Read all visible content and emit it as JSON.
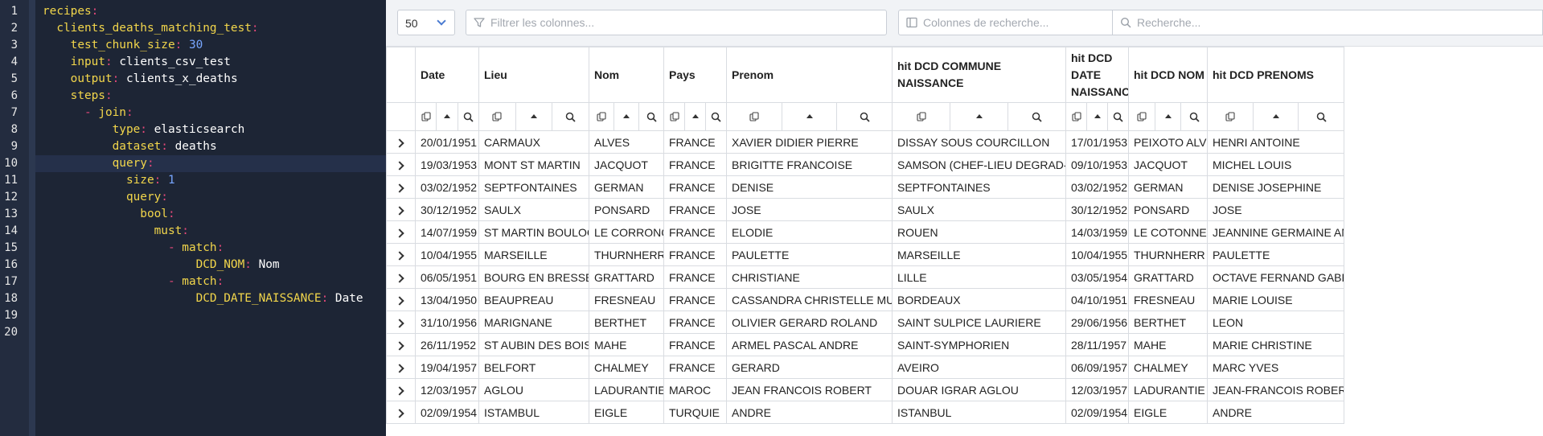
{
  "editor": {
    "line_numbers": [
      "1",
      "2",
      "3",
      "4",
      "5",
      "6",
      "7",
      "8",
      "9",
      "10",
      "11",
      "12",
      "13",
      "14",
      "15",
      "16",
      "17",
      "18",
      "19",
      "20"
    ],
    "lines": [
      {
        "indent": 0,
        "dash": false,
        "key": "recipes",
        "value": "",
        "vtype": ""
      },
      {
        "indent": 2,
        "dash": false,
        "key": "clients_deaths_matching_test",
        "value": "",
        "vtype": ""
      },
      {
        "indent": 4,
        "dash": false,
        "key": "test_chunk_size",
        "value": "30",
        "vtype": "num"
      },
      {
        "indent": 4,
        "dash": false,
        "key": "input",
        "value": "clients_csv_test",
        "vtype": "str"
      },
      {
        "indent": 4,
        "dash": false,
        "key": "output",
        "value": "clients_x_deaths",
        "vtype": "str"
      },
      {
        "indent": 4,
        "dash": false,
        "key": "steps",
        "value": "",
        "vtype": ""
      },
      {
        "indent": 6,
        "dash": true,
        "key": "join",
        "value": "",
        "vtype": ""
      },
      {
        "indent": 10,
        "dash": false,
        "key": "type",
        "value": "elasticsearch",
        "vtype": "str"
      },
      {
        "indent": 10,
        "dash": false,
        "key": "dataset",
        "value": "deaths",
        "vtype": "str"
      },
      {
        "indent": 10,
        "dash": false,
        "key": "query",
        "value": "",
        "vtype": ""
      },
      {
        "indent": 12,
        "dash": false,
        "key": "size",
        "value": "1",
        "vtype": "num"
      },
      {
        "indent": 12,
        "dash": false,
        "key": "query",
        "value": "",
        "vtype": ""
      },
      {
        "indent": 14,
        "dash": false,
        "key": "bool",
        "value": "",
        "vtype": ""
      },
      {
        "indent": 16,
        "dash": false,
        "key": "must",
        "value": "",
        "vtype": ""
      },
      {
        "indent": 18,
        "dash": true,
        "key": "match",
        "value": "",
        "vtype": ""
      },
      {
        "indent": 22,
        "dash": false,
        "key": "DCD_NOM",
        "value": "Nom",
        "vtype": "str"
      },
      {
        "indent": 18,
        "dash": true,
        "key": "match",
        "value": "",
        "vtype": ""
      },
      {
        "indent": 22,
        "dash": false,
        "key": "DCD_DATE_NAISSANCE",
        "value": "Date",
        "vtype": "str"
      },
      {
        "indent": 0,
        "dash": false,
        "key": "",
        "value": "",
        "vtype": ""
      },
      {
        "indent": 0,
        "dash": false,
        "key": "",
        "value": "",
        "vtype": ""
      }
    ],
    "active_line": 10
  },
  "toolbar": {
    "page_size": "50",
    "filter_placeholder": "Filtrer les colonnes...",
    "columns_placeholder": "Colonnes de recherche...",
    "search_placeholder": "Recherche..."
  },
  "table": {
    "columns": [
      "Date",
      "Lieu",
      "Nom",
      "Pays",
      "Prenom",
      "hit DCD COMMUNE NAISSANCE",
      "hit DCD DATE NAISSANCE",
      "hit DCD NOM",
      "hit DCD PRENOMS"
    ],
    "rows": [
      [
        "20/01/1951",
        "CARMAUX",
        "ALVES",
        "FRANCE",
        "XAVIER DIDIER PIERRE",
        "DISSAY SOUS COURCILLON",
        "17/01/1953",
        "PEIXOTO ALVES",
        "HENRI ANTOINE"
      ],
      [
        "19/03/1953",
        "MONT ST MARTIN",
        "JACQUOT",
        "FRANCE",
        "BRIGITTE FRANCOISE",
        "SAMSON (CHEF-LIEU DEGRAD-SAMSO",
        "09/10/1953",
        "JACQUOT",
        "MICHEL LOUIS"
      ],
      [
        "03/02/1952",
        "SEPTFONTAINES",
        "GERMAN",
        "FRANCE",
        "DENISE",
        "SEPTFONTAINES",
        "03/02/1952",
        "GERMAN",
        "DENISE JOSEPHINE"
      ],
      [
        "30/12/1952",
        "SAULX",
        "PONSARD",
        "FRANCE",
        "JOSE",
        "SAULX",
        "30/12/1952",
        "PONSARD",
        "JOSE"
      ],
      [
        "14/07/1959",
        "ST MARTIN BOULOGNE",
        "LE CORRONCQ",
        "FRANCE",
        "ELODIE",
        "ROUEN",
        "14/03/1959",
        "LE COTONNEC",
        "JEANNINE GERMAINE ANTOI"
      ],
      [
        "10/04/1955",
        "MARSEILLE",
        "THURNHERR",
        "FRANCE",
        "PAULETTE",
        "MARSEILLE",
        "10/04/1955",
        "THURNHERR",
        "PAULETTE"
      ],
      [
        "06/05/1951",
        "BOURG EN BRESSE",
        "GRATTARD",
        "FRANCE",
        "CHRISTIANE",
        "LILLE",
        "03/05/1954",
        "GRATTARD",
        "OCTAVE FERNAND GABRIEL"
      ],
      [
        "13/04/1950",
        "BEAUPREAU",
        "FRESNEAU",
        "FRANCE",
        "CASSANDRA CHRISTELLE MURIELLE",
        "BORDEAUX",
        "04/10/1951",
        "FRESNEAU",
        "MARIE LOUISE"
      ],
      [
        "31/10/1956",
        "MARIGNANE",
        "BERTHET",
        "FRANCE",
        "OLIVIER GERARD ROLAND",
        "SAINT SULPICE LAURIERE",
        "29/06/1956",
        "BERTHET",
        "LEON"
      ],
      [
        "26/11/1952",
        "ST AUBIN DES BOIS",
        "MAHE",
        "FRANCE",
        "ARMEL PASCAL ANDRE",
        "SAINT-SYMPHORIEN",
        "28/11/1957",
        "MAHE",
        "MARIE CHRISTINE"
      ],
      [
        "19/04/1957",
        "BELFORT",
        "CHALMEY",
        "FRANCE",
        "GERARD",
        "AVEIRO",
        "06/09/1957",
        "CHALMEY",
        "MARC YVES"
      ],
      [
        "12/03/1957",
        "AGLOU",
        "LADURANTIE",
        "MAROC",
        "JEAN FRANCOIS ROBERT",
        "DOUAR IGRAR AGLOU",
        "12/03/1957",
        "LADURANTIE",
        "JEAN-FRANCOIS ROBERT SAI"
      ],
      [
        "02/09/1954",
        "ISTAMBUL",
        "EIGLE",
        "TURQUIE",
        "ANDRE",
        "ISTANBUL",
        "02/09/1954",
        "EIGLE",
        "ANDRE"
      ]
    ]
  }
}
